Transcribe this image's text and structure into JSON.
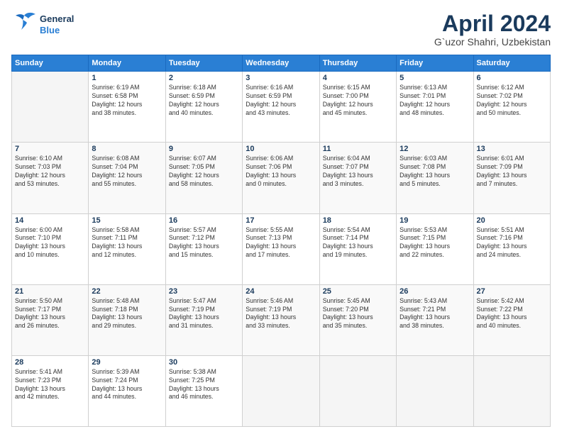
{
  "header": {
    "logo_general": "General",
    "logo_blue": "Blue",
    "title": "April 2024",
    "location": "G`uzor Shahri, Uzbekistan"
  },
  "days_of_week": [
    "Sunday",
    "Monday",
    "Tuesday",
    "Wednesday",
    "Thursday",
    "Friday",
    "Saturday"
  ],
  "weeks": [
    [
      {
        "day": "",
        "info": ""
      },
      {
        "day": "1",
        "info": "Sunrise: 6:19 AM\nSunset: 6:58 PM\nDaylight: 12 hours\nand 38 minutes."
      },
      {
        "day": "2",
        "info": "Sunrise: 6:18 AM\nSunset: 6:59 PM\nDaylight: 12 hours\nand 40 minutes."
      },
      {
        "day": "3",
        "info": "Sunrise: 6:16 AM\nSunset: 6:59 PM\nDaylight: 12 hours\nand 43 minutes."
      },
      {
        "day": "4",
        "info": "Sunrise: 6:15 AM\nSunset: 7:00 PM\nDaylight: 12 hours\nand 45 minutes."
      },
      {
        "day": "5",
        "info": "Sunrise: 6:13 AM\nSunset: 7:01 PM\nDaylight: 12 hours\nand 48 minutes."
      },
      {
        "day": "6",
        "info": "Sunrise: 6:12 AM\nSunset: 7:02 PM\nDaylight: 12 hours\nand 50 minutes."
      }
    ],
    [
      {
        "day": "7",
        "info": "Sunrise: 6:10 AM\nSunset: 7:03 PM\nDaylight: 12 hours\nand 53 minutes."
      },
      {
        "day": "8",
        "info": "Sunrise: 6:08 AM\nSunset: 7:04 PM\nDaylight: 12 hours\nand 55 minutes."
      },
      {
        "day": "9",
        "info": "Sunrise: 6:07 AM\nSunset: 7:05 PM\nDaylight: 12 hours\nand 58 minutes."
      },
      {
        "day": "10",
        "info": "Sunrise: 6:06 AM\nSunset: 7:06 PM\nDaylight: 13 hours\nand 0 minutes."
      },
      {
        "day": "11",
        "info": "Sunrise: 6:04 AM\nSunset: 7:07 PM\nDaylight: 13 hours\nand 3 minutes."
      },
      {
        "day": "12",
        "info": "Sunrise: 6:03 AM\nSunset: 7:08 PM\nDaylight: 13 hours\nand 5 minutes."
      },
      {
        "day": "13",
        "info": "Sunrise: 6:01 AM\nSunset: 7:09 PM\nDaylight: 13 hours\nand 7 minutes."
      }
    ],
    [
      {
        "day": "14",
        "info": "Sunrise: 6:00 AM\nSunset: 7:10 PM\nDaylight: 13 hours\nand 10 minutes."
      },
      {
        "day": "15",
        "info": "Sunrise: 5:58 AM\nSunset: 7:11 PM\nDaylight: 13 hours\nand 12 minutes."
      },
      {
        "day": "16",
        "info": "Sunrise: 5:57 AM\nSunset: 7:12 PM\nDaylight: 13 hours\nand 15 minutes."
      },
      {
        "day": "17",
        "info": "Sunrise: 5:55 AM\nSunset: 7:13 PM\nDaylight: 13 hours\nand 17 minutes."
      },
      {
        "day": "18",
        "info": "Sunrise: 5:54 AM\nSunset: 7:14 PM\nDaylight: 13 hours\nand 19 minutes."
      },
      {
        "day": "19",
        "info": "Sunrise: 5:53 AM\nSunset: 7:15 PM\nDaylight: 13 hours\nand 22 minutes."
      },
      {
        "day": "20",
        "info": "Sunrise: 5:51 AM\nSunset: 7:16 PM\nDaylight: 13 hours\nand 24 minutes."
      }
    ],
    [
      {
        "day": "21",
        "info": "Sunrise: 5:50 AM\nSunset: 7:17 PM\nDaylight: 13 hours\nand 26 minutes."
      },
      {
        "day": "22",
        "info": "Sunrise: 5:48 AM\nSunset: 7:18 PM\nDaylight: 13 hours\nand 29 minutes."
      },
      {
        "day": "23",
        "info": "Sunrise: 5:47 AM\nSunset: 7:19 PM\nDaylight: 13 hours\nand 31 minutes."
      },
      {
        "day": "24",
        "info": "Sunrise: 5:46 AM\nSunset: 7:19 PM\nDaylight: 13 hours\nand 33 minutes."
      },
      {
        "day": "25",
        "info": "Sunrise: 5:45 AM\nSunset: 7:20 PM\nDaylight: 13 hours\nand 35 minutes."
      },
      {
        "day": "26",
        "info": "Sunrise: 5:43 AM\nSunset: 7:21 PM\nDaylight: 13 hours\nand 38 minutes."
      },
      {
        "day": "27",
        "info": "Sunrise: 5:42 AM\nSunset: 7:22 PM\nDaylight: 13 hours\nand 40 minutes."
      }
    ],
    [
      {
        "day": "28",
        "info": "Sunrise: 5:41 AM\nSunset: 7:23 PM\nDaylight: 13 hours\nand 42 minutes."
      },
      {
        "day": "29",
        "info": "Sunrise: 5:39 AM\nSunset: 7:24 PM\nDaylight: 13 hours\nand 44 minutes."
      },
      {
        "day": "30",
        "info": "Sunrise: 5:38 AM\nSunset: 7:25 PM\nDaylight: 13 hours\nand 46 minutes."
      },
      {
        "day": "",
        "info": ""
      },
      {
        "day": "",
        "info": ""
      },
      {
        "day": "",
        "info": ""
      },
      {
        "day": "",
        "info": ""
      }
    ]
  ]
}
